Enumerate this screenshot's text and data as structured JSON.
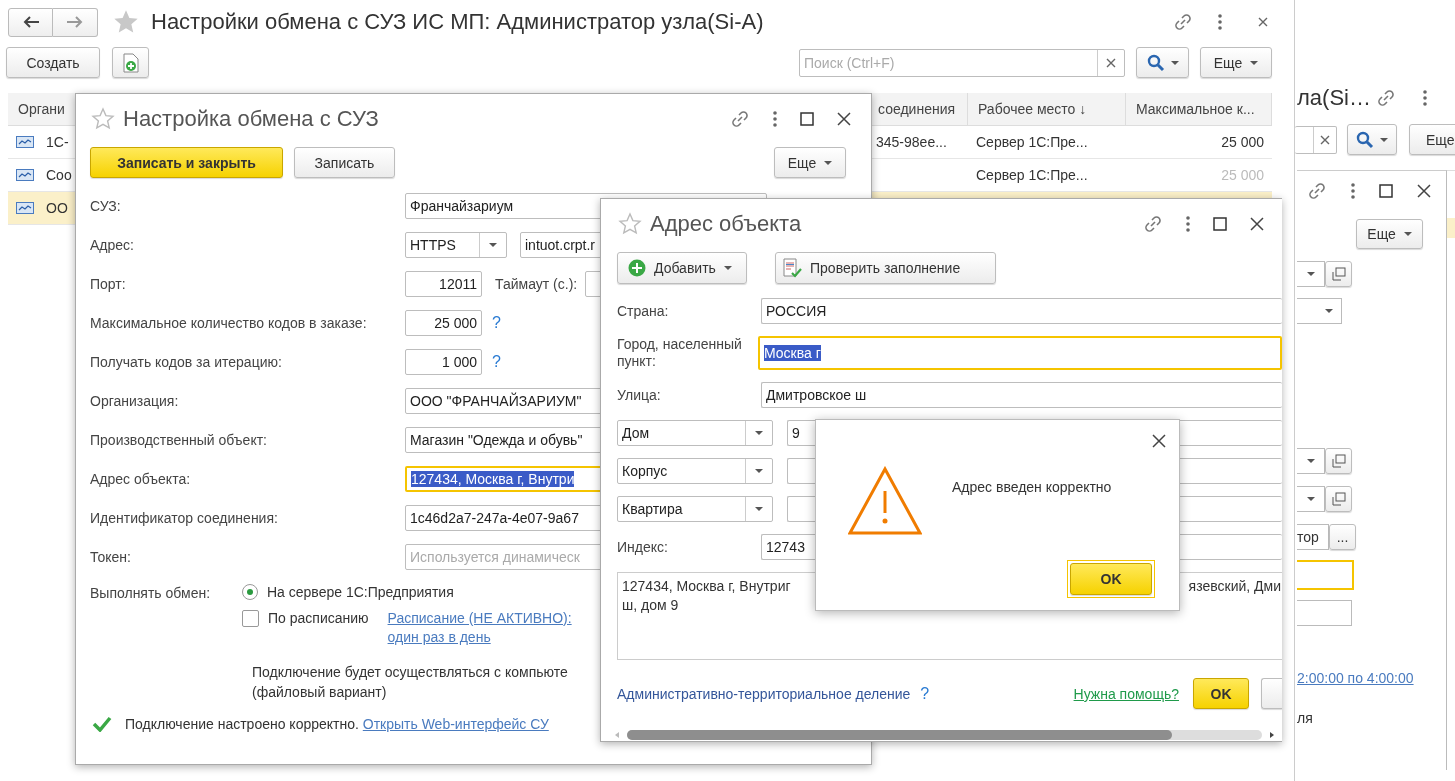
{
  "main_window": {
    "title": "Настройки обмена с СУЗ ИС МП: Администратор узла(Si-A)",
    "toolbar": {
      "create_button": "Создать",
      "search": {
        "placeholder": "Поиск (Ctrl+F)"
      },
      "more_button": "Еще"
    },
    "table": {
      "columns": [
        "Органи",
        "соединения",
        "Рабочее место ↓",
        "Максимальное к..."
      ],
      "rows": [
        {
          "column_1": "1С-",
          "column_2": "345-98ee...",
          "column_3": "Сервер 1С:Пре...",
          "column_4": "25 000",
          "column_4_dimmed": false,
          "selected": false
        },
        {
          "column_1": "Соо",
          "column_3": "Сервер 1С:Пре...",
          "column_4": "25 000",
          "column_4_dimmed": true,
          "selected": false
        },
        {
          "column_1": "ОО",
          "selected": true
        }
      ]
    }
  },
  "settings_dialog": {
    "title": "Настройка обмена с СУЗ",
    "buttons": {
      "save_close": "Записать и закрыть",
      "save": "Записать",
      "more": "Еще"
    },
    "fields": [
      {
        "kind": "choice",
        "label": "СУЗ:",
        "value": "Франчайзариум",
        "focused": false
      },
      {
        "kind": "protocol",
        "label": "Адрес:",
        "protocol": "HTTPS",
        "value": "intuot.crpt.r"
      },
      {
        "kind": "number_extra",
        "label": "Порт:",
        "value": "12011",
        "extra_label": "Таймаут (с.):"
      },
      {
        "kind": "number_help",
        "label": "Максимальное количество кодов в заказе:",
        "value": "25 000",
        "help": "?"
      },
      {
        "kind": "number_help",
        "label": "Получать кодов за итерацию:",
        "value": "1 000",
        "help": "?"
      },
      {
        "kind": "text",
        "label": "Организация:",
        "value": "ООО \"ФРАНЧАЙЗАРИУМ\"",
        "focused": false
      },
      {
        "kind": "text",
        "label": "Производственный объект:",
        "value": "Магазин \"Одежда и обувь\"",
        "focused": false
      },
      {
        "kind": "text",
        "label": "Адрес объекта:",
        "value": "127434, Москва г, Внутри",
        "focused": true
      },
      {
        "kind": "text",
        "label": "Идентификатор соединения:",
        "value": "1c46d2a7-247a-4e07-9a67",
        "focused": false
      },
      {
        "kind": "text",
        "label": "Токен:",
        "placeholder": "Используется динамическ",
        "focused": false
      }
    ],
    "exchange": {
      "label": "Выполнять обмен:",
      "options": [
        {
          "kind": "radio",
          "label": "На сервере 1С:Предприятия",
          "selected": true
        },
        {
          "kind": "checkbox",
          "label": "По расписанию",
          "checked": false,
          "link_lines": [
            "Расписание (НЕ АКТИВНО):",
            "один раз в день"
          ]
        }
      ],
      "note_lines": [
        "Подключение будет осуществляться с компьюте",
        "(файловый вариант)"
      ]
    },
    "status": {
      "ok": true,
      "text": "Подключение настроено корректно.",
      "link": "Открыть Web-интерфейс СУ"
    }
  },
  "address_dialog": {
    "title": "Адрес объекта",
    "toolbar": {
      "add_button": "Добавить",
      "check_button": "Проверить заполнение"
    },
    "fields": [
      {
        "kind": "text",
        "label": "Страна:",
        "value": "РОССИЯ",
        "focused": false
      },
      {
        "kind": "text",
        "label": "Город, населенный пункт:",
        "value": "Москва г",
        "focused": true
      },
      {
        "kind": "text",
        "label": "Улица:",
        "value": "Дмитровское ш",
        "focused": false
      },
      {
        "kind": "typed",
        "type": "Дом",
        "value": "9"
      },
      {
        "kind": "typed",
        "type": "Корпус"
      },
      {
        "kind": "typed",
        "type": "Квартира"
      },
      {
        "kind": "text",
        "label": "Индекс:",
        "value": "12743",
        "focused": false
      }
    ],
    "presentation": {
      "line_1_start": "127434, Москва г, Внутриг",
      "line_1_end": "язевский, Дми",
      "line_2": "ш, дом 9"
    },
    "footer": {
      "division_link": "Административно-территориальное деление",
      "help": "?",
      "help_link": "Нужна помощь?",
      "ok_button": "OK"
    }
  },
  "message_box": {
    "text": "Адрес введен корректно",
    "ok_button": "OK"
  },
  "background_window": {
    "title": "ла(Si…",
    "more_button": "Еще",
    "inner_more_button": "Еще",
    "fragment_text": "тор",
    "ellipsis_button": "...",
    "schedule_link": "2:00:00 по 4:00:00",
    "text_tail": "ля"
  }
}
